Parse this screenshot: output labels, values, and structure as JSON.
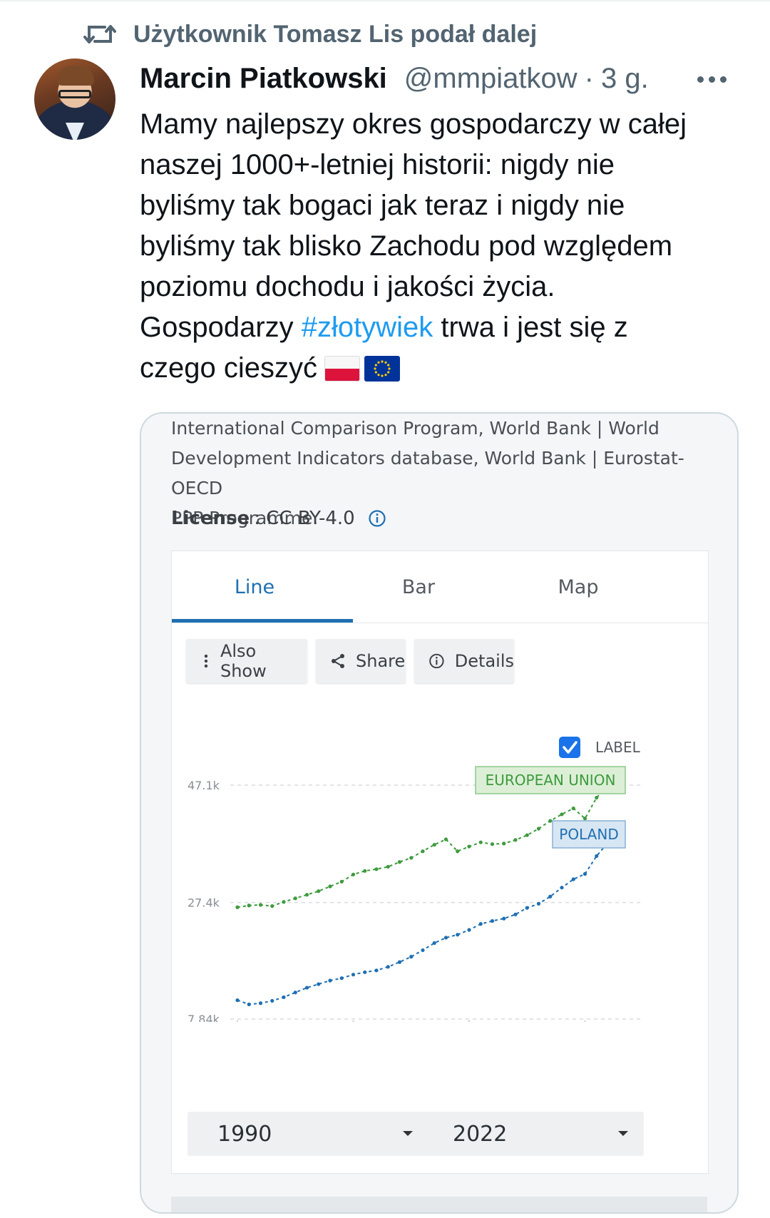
{
  "retweet": {
    "icon": "retweet-icon",
    "label": "Użytkownik Tomasz Lis podał dalej"
  },
  "author": {
    "name": "Marcin Piatkowski",
    "handle": "@mmpiatkow",
    "separator": "·",
    "time": "3 g."
  },
  "tweet": {
    "lines": [
      "Mamy najlepszy okres gospodarczy w całej",
      "naszej 1000+-letniej historii: nigdy nie",
      "byliśmy tak bogaci jak teraz i nigdy nie",
      "byliśmy tak blisko Zachodu pod względem",
      "poziomu dochodu i jakości życia."
    ],
    "last_prefix": "Gospodarzy ",
    "hashtag": "#złotywiek",
    "last_suffix": " trwa i jest się z",
    "final_line": "czego cieszyć",
    "flags": [
      "flag-poland",
      "flag-eu"
    ]
  },
  "card": {
    "source_lines": [
      "International Comparison Program, World Bank | World",
      "Development Indicators database, World Bank | Eurostat-OECD",
      "PPP Programme."
    ],
    "license_label": "License",
    "license_value": ": CC BY-4.0",
    "tabs": [
      "Line",
      "Bar",
      "Map"
    ],
    "active_tab": "Line",
    "actions": {
      "also_show": "Also Show",
      "share": "Share",
      "details": "Details"
    },
    "label_checkbox": {
      "checked": true,
      "text": "LABEL"
    },
    "start_year": "1990",
    "end_year": "2022"
  },
  "colors": {
    "accent_link": "#1d9bf0",
    "tab_active": "#1f6fb2",
    "eu_series": "#3e9a3e",
    "poland_series": "#1f6fb2"
  },
  "chart_data": {
    "type": "line",
    "x": [
      1990,
      1991,
      1992,
      1993,
      1994,
      1995,
      1996,
      1997,
      1998,
      1999,
      2000,
      2001,
      2002,
      2003,
      2004,
      2005,
      2006,
      2007,
      2008,
      2009,
      2010,
      2011,
      2012,
      2013,
      2014,
      2015,
      2016,
      2017,
      2018,
      2019,
      2020,
      2021,
      2022
    ],
    "ytick_labels": [
      "47.1k",
      "27.4k",
      "7.84k"
    ],
    "ytick_values": [
      47100,
      27400,
      7840
    ],
    "ylim": [
      7840,
      47100
    ],
    "xtick_positions": [
      1990,
      2000,
      2010,
      2020
    ],
    "grid": true,
    "series": [
      {
        "name": "EUROPEAN UNION",
        "color": "#3e9a3e",
        "values": [
          26600,
          26900,
          27000,
          26800,
          27500,
          28100,
          28700,
          29300,
          30100,
          30900,
          32100,
          32700,
          33000,
          33400,
          34200,
          34900,
          36000,
          37100,
          38000,
          36000,
          36800,
          37500,
          37200,
          37300,
          37900,
          38700,
          39800,
          41100,
          42200,
          43200,
          41500,
          45000,
          47100
        ]
      },
      {
        "name": "POLAND",
        "color": "#1f6fb2",
        "values": [
          11000,
          10300,
          10500,
          10900,
          11500,
          12300,
          13100,
          13700,
          14300,
          14700,
          15300,
          15700,
          16000,
          16600,
          17400,
          18300,
          19400,
          20600,
          21500,
          22000,
          22800,
          23800,
          24300,
          24700,
          25400,
          26500,
          27200,
          28400,
          29900,
          31300,
          32200,
          35200,
          37500
        ]
      }
    ]
  }
}
